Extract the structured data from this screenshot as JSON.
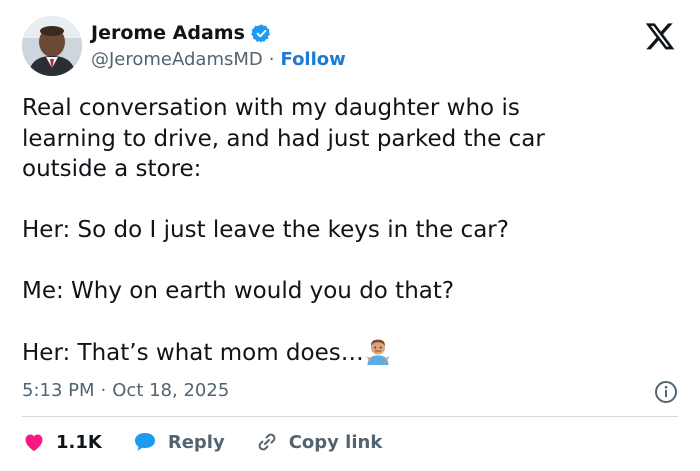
{
  "author": {
    "display_name": "Jerome Adams",
    "handle": "@JeromeAdamsMD",
    "separator": "·",
    "follow_label": "Follow"
  },
  "tweet": {
    "lines": [
      "Real conversation with my daughter who is",
      "learning to drive, and had just parked the car",
      "outside a store:",
      "",
      "Her: So do I just leave the keys in the car?",
      "",
      "Me: Why on earth would you do that?",
      "",
      "Her: That’s what mom does…"
    ],
    "emoji": "man-shrugging"
  },
  "meta": {
    "time": "5:13 PM",
    "separator": "·",
    "date": "Oct 18, 2025"
  },
  "actions": {
    "like_count": "1.1K",
    "reply_label": "Reply",
    "copy_label": "Copy link"
  },
  "colors": {
    "accent": "#1d9bf0",
    "like": "#f91880",
    "muted": "#536471",
    "divider": "#cfd9de"
  },
  "icons": [
    "verified-badge-icon",
    "x-logo-icon",
    "info-icon",
    "heart-icon",
    "reply-icon",
    "link-icon",
    "man-shrugging-emoji"
  ]
}
